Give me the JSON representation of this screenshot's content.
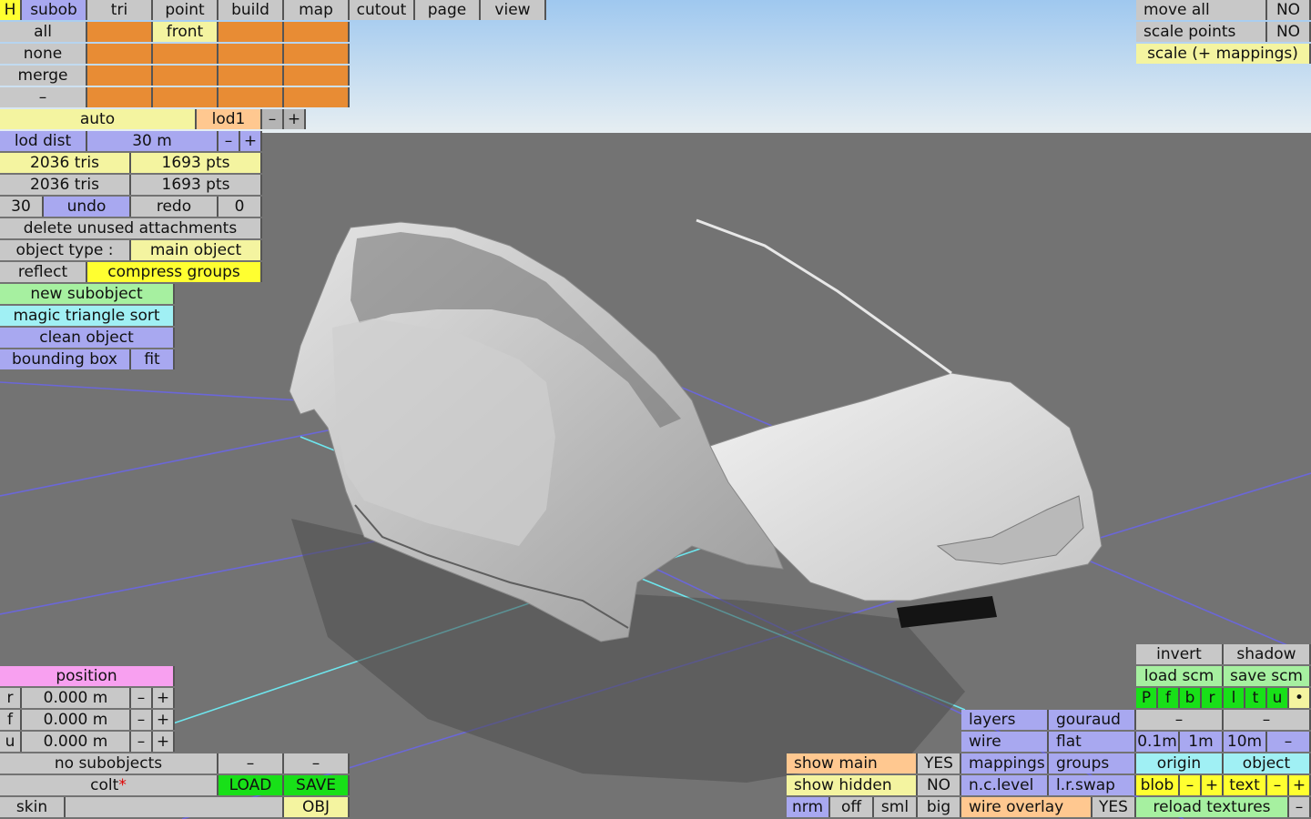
{
  "menu": {
    "h": "H",
    "items": [
      "subob",
      "tri",
      "point",
      "build",
      "map",
      "cutout",
      "page",
      "view"
    ]
  },
  "selection": {
    "all": "all",
    "front": "front",
    "none": "none",
    "merge": "merge",
    "dash": "–"
  },
  "lod": {
    "auto": "auto",
    "name": "lod1",
    "minus": "–",
    "plus": "+",
    "dist_label": "lod dist",
    "dist_value": "30 m"
  },
  "counts": {
    "tris1": "2036 tris",
    "pts1": "1693 pts",
    "tris2": "2036 tris",
    "pts2": "1693 pts"
  },
  "undo": {
    "left_num": "30",
    "undo": "undo",
    "redo": "redo",
    "right_num": "0"
  },
  "actions": {
    "delete_unused": "delete unused attachments",
    "object_type_label": "object type :",
    "object_type_value": "main object",
    "reflect": "reflect",
    "compress": "compress groups",
    "new_subobject": "new subobject",
    "magic_sort": "magic triangle sort",
    "clean_object": "clean object",
    "bounding_box": "bounding box",
    "fit": "fit"
  },
  "position": {
    "title": "position",
    "rows": [
      {
        "axis": "r",
        "value": "0.000 m"
      },
      {
        "axis": "f",
        "value": "0.000 m"
      },
      {
        "axis": "u",
        "value": "0.000 m"
      }
    ],
    "minus": "–",
    "plus": "+"
  },
  "bottom_left": {
    "no_subobjects": "no subobjects",
    "dash1": "–",
    "dash2": "–",
    "file_name": "colt",
    "modified_mark": "*",
    "load": "LOAD",
    "save": "SAVE",
    "skin": "skin",
    "skin_value": "",
    "obj": "OBJ"
  },
  "top_right": {
    "move_all": "move all",
    "move_all_val": "NO",
    "scale_points": "scale points",
    "scale_points_val": "NO",
    "scale_mappings": "scale (+ mappings)"
  },
  "display": {
    "show_main": "show main",
    "show_main_val": "YES",
    "show_hidden": "show hidden",
    "show_hidden_val": "NO",
    "nrm": "nrm",
    "off": "off",
    "sml": "sml",
    "big": "big"
  },
  "render": {
    "layers": "layers",
    "gouraud": "gouraud",
    "wire": "wire",
    "flat": "flat",
    "mappings": "mappings",
    "groups": "groups",
    "nclevel": "n.c.level",
    "lrswap": "l.r.swap",
    "wire_overlay": "wire overlay",
    "wire_overlay_val": "YES"
  },
  "right_panel": {
    "invert": "invert",
    "shadow": "shadow",
    "load_scm": "load scm",
    "save_scm": "save scm",
    "views": [
      "P",
      "f",
      "b",
      "r",
      "l",
      "t",
      "u",
      "•"
    ],
    "dash": "–",
    "grid": [
      "0.1m",
      "1m",
      "10m",
      "–"
    ],
    "origin": "origin",
    "object": "object",
    "blob": "blob",
    "text": "text",
    "minus": "–",
    "plus": "+",
    "reload": "reload textures",
    "end_dash": "–"
  },
  "colors": {
    "sky_top": "#9fc8ef",
    "sky_bottom": "#e6eef2",
    "ground": "#737373",
    "grid_line": "#6b67d8",
    "axis_line": "#6ee6ee"
  }
}
